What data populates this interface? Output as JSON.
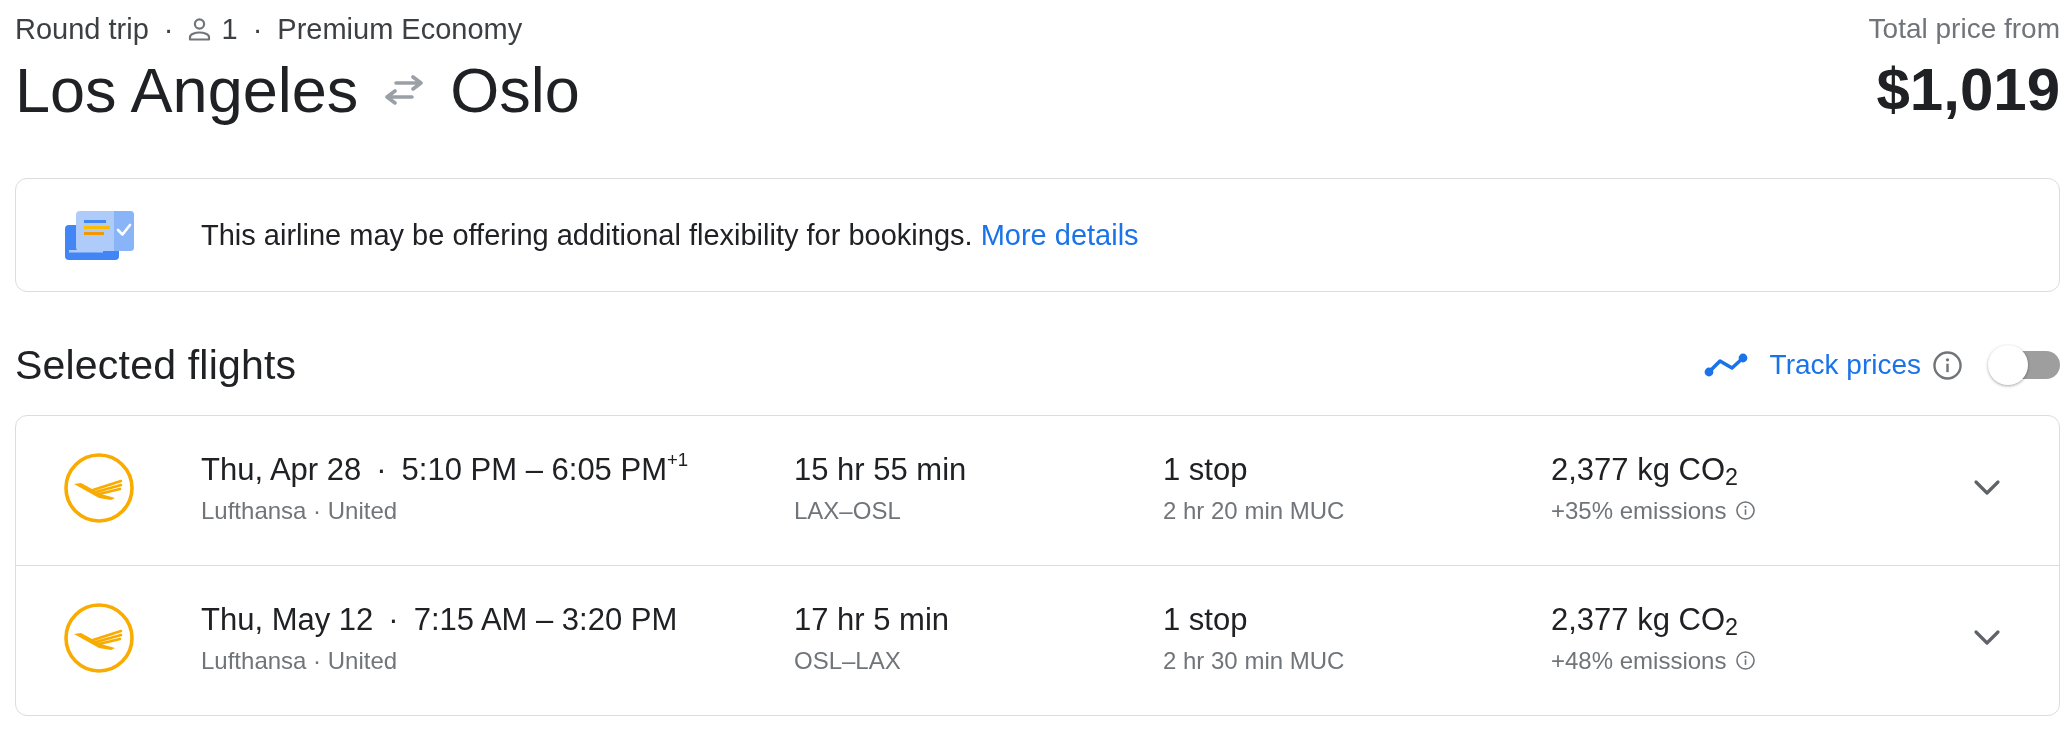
{
  "trip_summary": [
    {
      "kind": "trip_type",
      "text": "Round trip"
    },
    {
      "kind": "separator",
      "text": "·"
    },
    {
      "kind": "passengers",
      "text": "1"
    },
    {
      "kind": "separator",
      "text": "·"
    },
    {
      "kind": "cabin_class",
      "text": "Premium Economy"
    }
  ],
  "route": {
    "origin": "Los Angeles",
    "destination": "Oslo"
  },
  "price": {
    "label": "Total price from",
    "amount": "$1,019"
  },
  "banner": {
    "message": "This airline may be offering additional flexibility for bookings.",
    "link": "More details"
  },
  "selected_flights": {
    "title": "Selected flights",
    "track_prices": {
      "label": "Track prices",
      "on": false
    },
    "flights": [
      {
        "date": "Thu, Apr 28",
        "separator": "·",
        "times": "5:10 PM – 6:05 PM$^{+1}$",
        "airlines": "Lufthansa · United",
        "duration": "15 hr 55 min",
        "route": "LAX–OSL",
        "stops": "1 stop",
        "layover": "2 hr 20 min MUC",
        "emissions": "2,377 kg CO$_{2}$",
        "emissions_change": "+35% emissions",
        "expanded": false
      },
      {
        "date": "Thu, May 12",
        "separator": "·",
        "times": "7:15 AM – 3:20 PM",
        "airlines": "Lufthansa · United",
        "duration": "17 hr 5 min",
        "route": "OSL–LAX",
        "stops": "1 stop",
        "layover": "2 hr 30 min MUC",
        "emissions": "2,377 kg CO$_{2}$",
        "emissions_change": "+48% emissions",
        "expanded": false
      }
    ]
  }
}
